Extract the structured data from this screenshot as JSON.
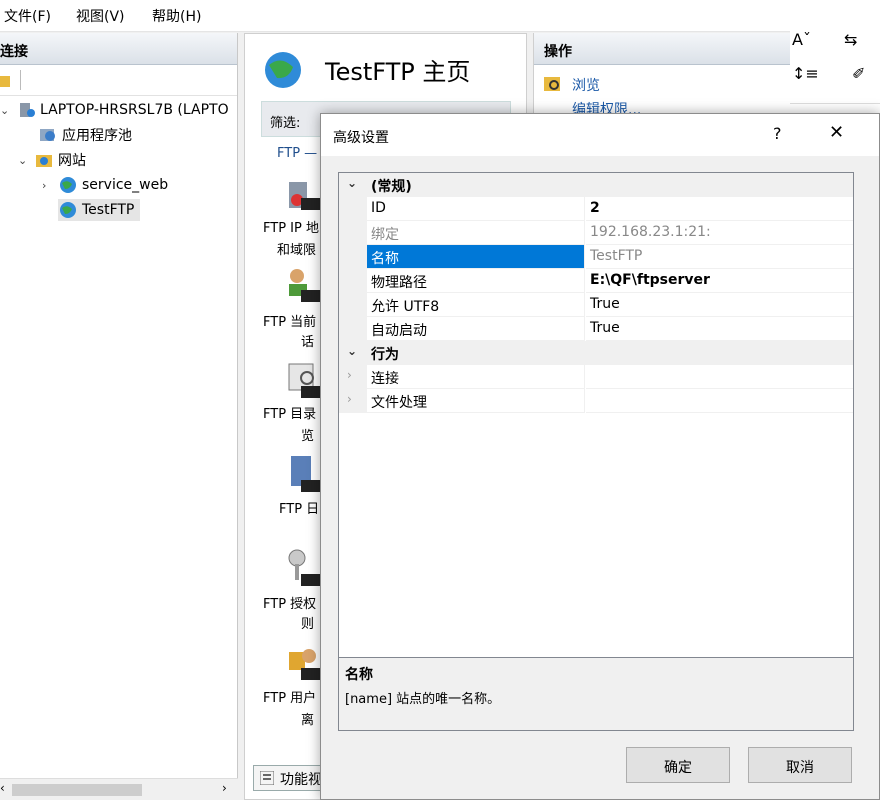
{
  "menu": {
    "file": "文件(F)",
    "view": "视图(V)",
    "help": "帮助(H)"
  },
  "connections": {
    "header": "连接",
    "tree": {
      "server": "LAPTOP-HRSRSL7B (LAPTO",
      "app_pools": "应用程序池",
      "sites": "网站",
      "site1": "service_web",
      "site2": "TestFTP"
    }
  },
  "home": {
    "title": "TestFTP 主页",
    "filter_label": "筛选:",
    "group_label": "FTP —",
    "features": [
      {
        "line1": "FTP IP 地",
        "line2": "和域限"
      },
      {
        "line1": "FTP 当前",
        "line2": "话"
      },
      {
        "line1": "FTP 目录",
        "line2": "览"
      },
      {
        "line1": "FTP 日",
        "line2": ""
      },
      {
        "line1": "FTP 授权",
        "line2": "则"
      },
      {
        "line1": "FTP 用户",
        "line2": "离"
      }
    ],
    "view_tab": "功能视"
  },
  "actions": {
    "header": "操作",
    "browse": "浏览",
    "edit_perm": "编辑权限..."
  },
  "dialog": {
    "title": "高级设置",
    "help": "?",
    "close": "✕",
    "cat_general": "(常规)",
    "rows": {
      "id_name": "ID",
      "id_val": "2",
      "bind_name": "绑定",
      "bind_val": "192.168.23.1:21:",
      "name_name": "名称",
      "name_val": "TestFTP",
      "path_name": "物理路径",
      "path_val": "E:\\QF\\ftpserver",
      "utf8_name": "允许 UTF8",
      "utf8_val": "True",
      "auto_name": "自动启动",
      "auto_val": "True"
    },
    "cat_behavior": "行为",
    "sub1": "连接",
    "sub2": "文件处理",
    "desc_title": "名称",
    "desc_text": "[name] 站点的唯一名称。",
    "ok": "确定",
    "cancel": "取消"
  }
}
